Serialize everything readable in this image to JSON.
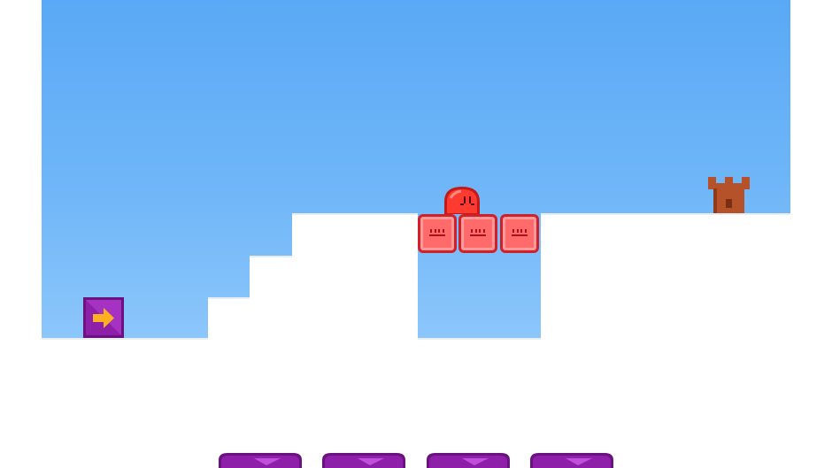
{
  "scene": {
    "sky_color": "#5aa9f6",
    "ground_color": "#ffffff",
    "block_color": "#ff6b6b",
    "block_border_color": "#d0202a",
    "hero_color": "#ff3b30",
    "castle_color": "#b5522a",
    "tile_color": "#8e1fa8",
    "arrow_color": "#ffb020"
  },
  "entities": {
    "hero": "red-blob-hero",
    "blocks": [
      "red-face-block",
      "red-face-block",
      "red-face-block"
    ],
    "goal": "castle-tower-icon",
    "start_tile": "right-arrow-tile"
  },
  "controls": {
    "buttons": [
      "purple-control-button",
      "purple-control-button",
      "purple-control-button",
      "purple-control-button"
    ]
  }
}
